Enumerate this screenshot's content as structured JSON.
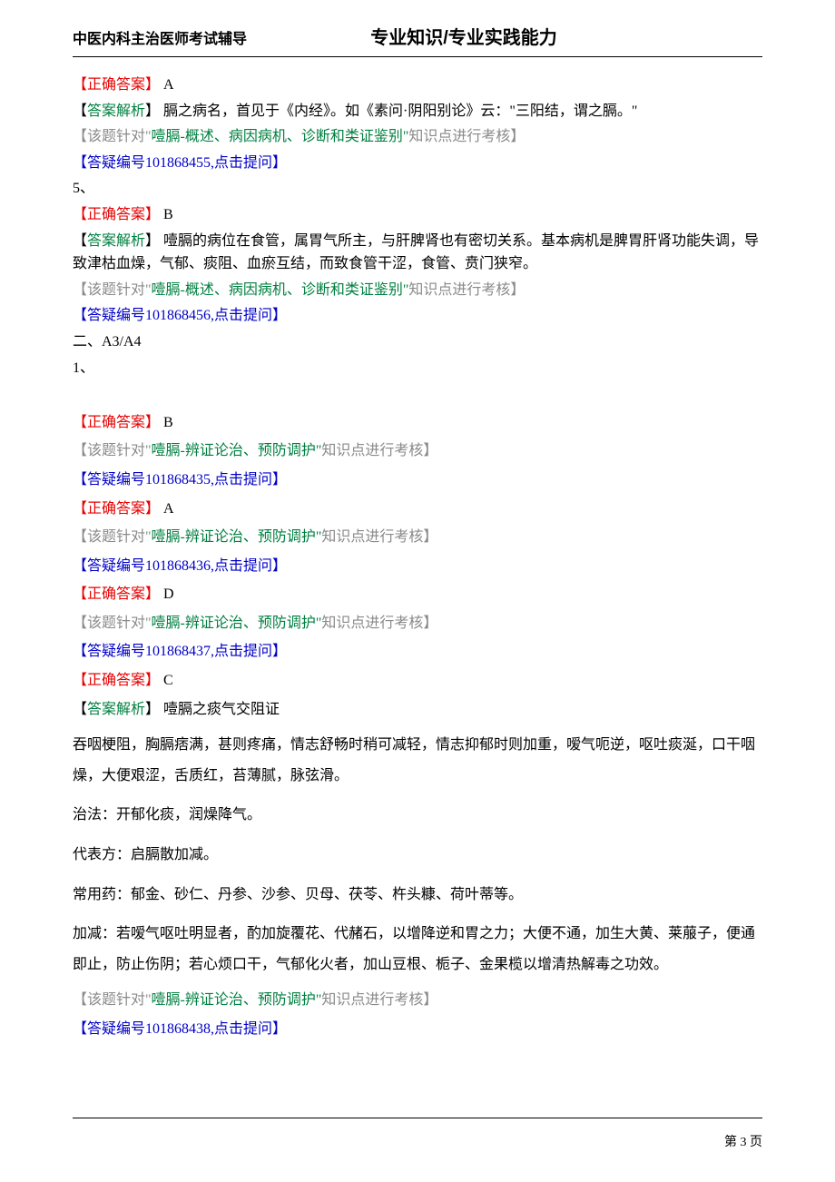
{
  "header": {
    "left": "中医内科主治医师考试辅导",
    "center": "专业知识/专业实践能力"
  },
  "labels": {
    "correct_answer": "【正确答案】",
    "answer_analysis_open": "【",
    "answer_analysis_label": "答案解析",
    "answer_analysis_close": "】",
    "topic_open": "【该题针对\"",
    "topic_close": "知识点进行考核】",
    "link_open": "【答疑编号",
    "link_action": ",点击提问】"
  },
  "items": [
    {
      "answer": " A",
      "analysis": " 膈之病名，首见于《内经》。如《素问·阴阳别论》云：\"三阳结，谓之膈。\"",
      "topic_main": "噎膈-概述、病因病机、诊断和类证鉴别\"",
      "link_id": "101868455"
    },
    {
      "question_num": "5、",
      "answer": " B",
      "analysis": " 噎膈的病位在食管，属胃气所主，与肝脾肾也有密切关系。基本病机是脾胃肝肾功能失调，导致津枯血燥，气郁、痰阻、血瘀互结，而致食管干涩，食管、贲门狭窄。",
      "topic_main": "噎膈-概述、病因病机、诊断和类证鉴别\"",
      "link_id": "101868456"
    }
  ],
  "section2_heading": "二、A3/A4",
  "section2_q": "1、",
  "section2_items": [
    {
      "answer": " B",
      "topic_main": "噎膈-辨证论治、预防调护\"",
      "link_id": "101868435"
    },
    {
      "answer": " A",
      "topic_main": "噎膈-辨证论治、预防调护\"",
      "link_id": "101868436"
    },
    {
      "answer": " D",
      "topic_main": "噎膈-辨证论治、预防调护\"",
      "link_id": "101868437"
    },
    {
      "answer": " C",
      "topic_main": "噎膈-辨证论治、预防调护\"",
      "link_id": "101868438",
      "has_analysis": true
    }
  ],
  "analysisC": {
    "line1": " 噎膈之痰气交阻证",
    "lines": [
      "吞咽梗阻，胸膈痞满，甚则疼痛，情志舒畅时稍可减轻，情志抑郁时则加重，嗳气呃逆，呕吐痰涎，口干咽燥，大便艰涩，舌质红，苔薄腻，脉弦滑。",
      "治法：开郁化痰，润燥降气。",
      "代表方：启膈散加减。",
      "常用药：郁金、砂仁、丹参、沙参、贝母、茯苓、杵头糠、荷叶蒂等。",
      "加减：若嗳气呕吐明显者，酌加旋覆花、代赭石，以增降逆和胃之力；大便不通，加生大黄、莱菔子，便通即止，防止伤阴；若心烦口干，气郁化火者，加山豆根、栀子、金果榄以增清热解毒之功效。"
    ]
  },
  "footer": {
    "page_label": "第 3 页"
  }
}
